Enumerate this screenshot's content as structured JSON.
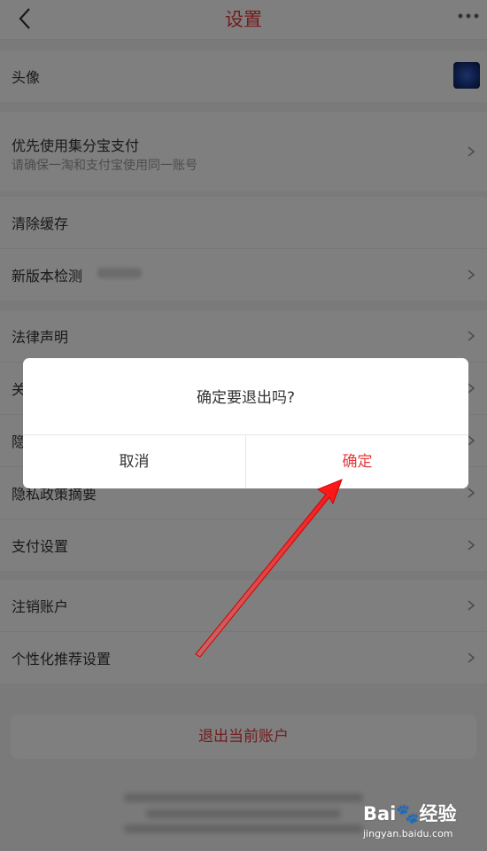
{
  "nav": {
    "title": "设置"
  },
  "rows": {
    "avatar_label": "头像",
    "pay_label": "优先使用集分宝支付",
    "pay_sub": "请确保一淘和支付宝使用同一账号",
    "cache_label": "清除缓存",
    "version_label": "新版本检测",
    "legal_label": "法律声明",
    "about_label": "关",
    "privacy_label": "隐",
    "privacy_summary_label": "隐私政策摘要",
    "payment_settings_label": "支付设置",
    "cancel_account_label": "注销账户",
    "personal_rec_label": "个性化推荐设置"
  },
  "logout": {
    "label": "退出当前账户"
  },
  "dialog": {
    "message": "确定要退出吗?",
    "cancel": "取消",
    "confirm": "确定"
  },
  "watermark": {
    "logo": "Bai🐾经验",
    "site": "jingyan.baidu.com"
  },
  "colors": {
    "accent": "#e4393c",
    "background": "#f5f5f5",
    "overlay": "rgba(0,0,0,0.5)",
    "arrow": "#ff1a1a"
  }
}
